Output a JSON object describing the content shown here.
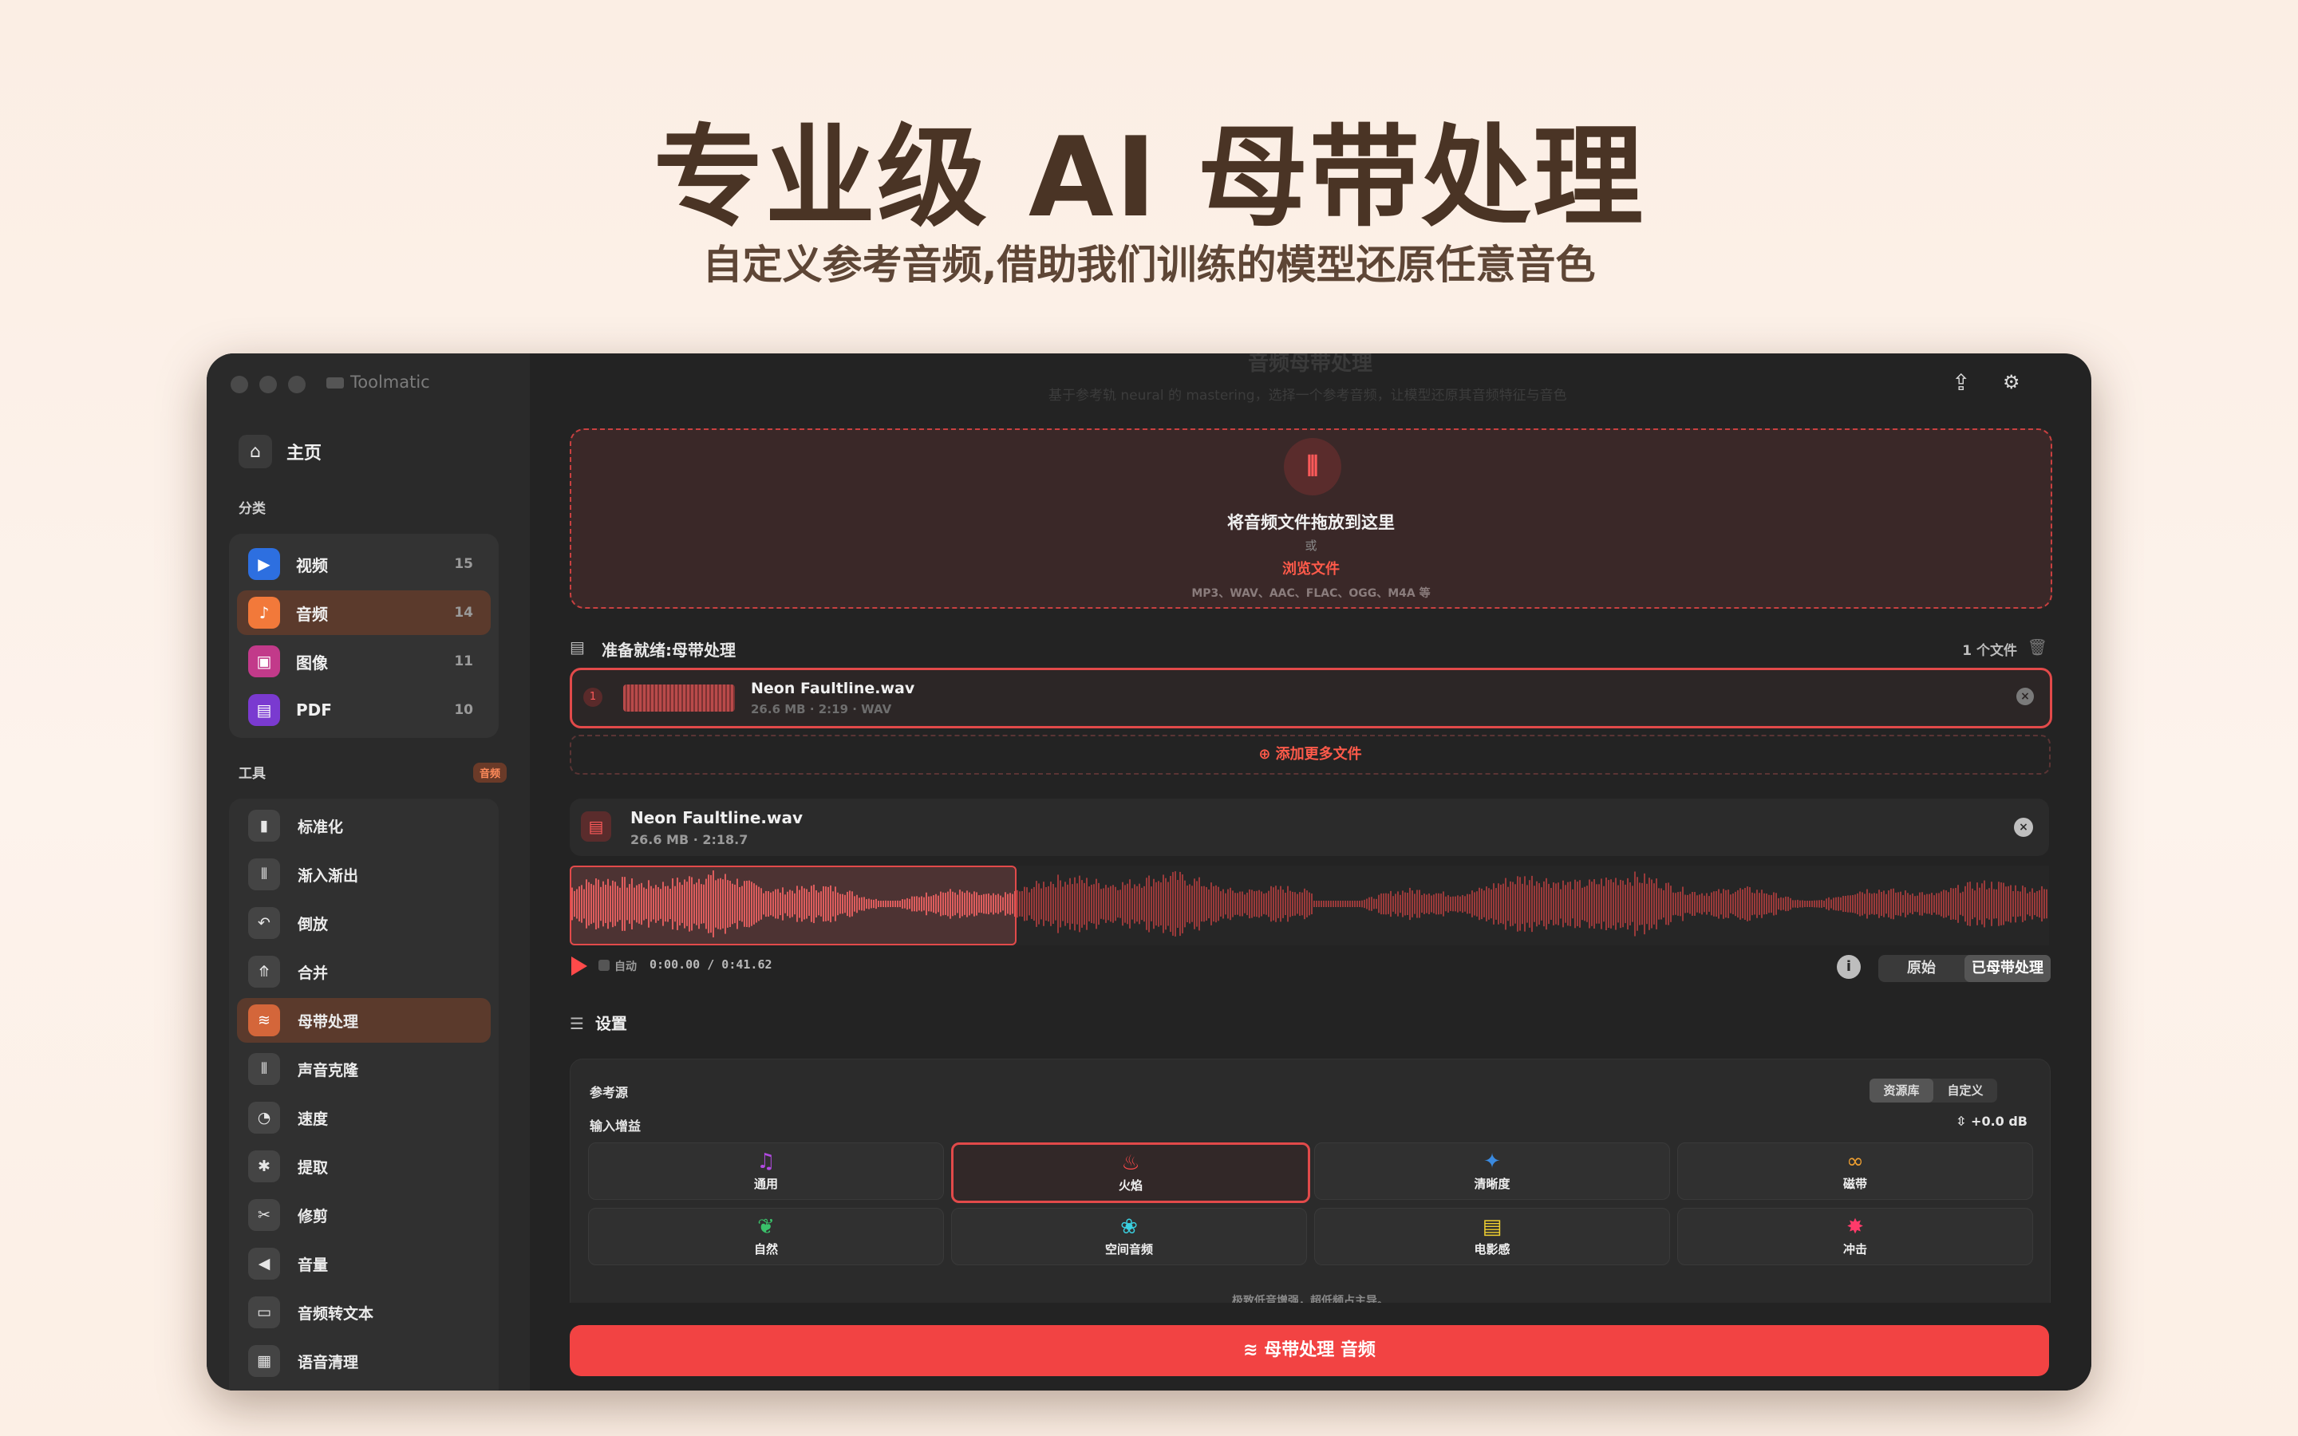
{
  "hero": {
    "title": "专业级 AI 母带处理",
    "subtitle": "自定义参考音频,借助我们训练的模型还原任意音色"
  },
  "window": {
    "app_name": "Toolmatic",
    "header_title": "音频母带处理",
    "header_subtitle": "基于参考轨 neural 的 mastering，选择一个参考音频，让模型还原其音频特征与音色"
  },
  "sidebar": {
    "home_label": "主页",
    "categories_label": "分类",
    "categories": [
      {
        "label": "视频",
        "count": "15",
        "color": "#2d6fe0",
        "icon": "video-icon"
      },
      {
        "label": "音频",
        "count": "14",
        "color": "#f2793a",
        "icon": "music-icon",
        "active": true
      },
      {
        "label": "图像",
        "count": "11",
        "color": "#c23a8a",
        "icon": "image-icon"
      },
      {
        "label": "PDF",
        "count": "10",
        "color": "#7a3ad0",
        "icon": "pdf-icon"
      }
    ],
    "tools_label": "工具",
    "tools_badge": "音频",
    "tools": [
      {
        "label": "标准化",
        "icon": "normalize-icon",
        "glyph": "▮"
      },
      {
        "label": "渐入渐出",
        "icon": "fade-icon",
        "glyph": "⦀"
      },
      {
        "label": "倒放",
        "icon": "reverse-icon",
        "glyph": "↶"
      },
      {
        "label": "合并",
        "icon": "merge-icon",
        "glyph": "⤊"
      },
      {
        "label": "母带处理",
        "icon": "mastering-icon",
        "glyph": "≋",
        "active": true
      },
      {
        "label": "声音克隆",
        "icon": "voice-clone-icon",
        "glyph": "⦀"
      },
      {
        "label": "速度",
        "icon": "speed-icon",
        "glyph": "◔"
      },
      {
        "label": "提取",
        "icon": "extract-icon",
        "glyph": "✱"
      },
      {
        "label": "修剪",
        "icon": "scissors-icon",
        "glyph": "✂"
      },
      {
        "label": "音量",
        "icon": "volume-icon",
        "glyph": "◀"
      },
      {
        "label": "音频转文本",
        "icon": "transcribe-icon",
        "glyph": "▭"
      },
      {
        "label": "语音清理",
        "icon": "voice-clean-icon",
        "glyph": "▦"
      }
    ]
  },
  "dropzone": {
    "title": "将音频文件拖放到这里",
    "or": "或",
    "browse": "浏览文件",
    "formats": "MP3、WAV、AAC、FLAC、OGG、M4A 等"
  },
  "queue": {
    "label": "准备就绪:母带处理",
    "count": "1 个文件",
    "file": {
      "index": "1",
      "name": "Neon Faultline.wav",
      "meta": "26.6 MB · 2:19 · WAV"
    },
    "add_more": "添加更多文件"
  },
  "player": {
    "name": "Neon Faultline.wav",
    "meta": "26.6 MB  ·  2:18.7",
    "auto_label": "自动",
    "time": "0:00.00  /  0:41.62",
    "compare_options": [
      "原始",
      "已母带处理"
    ],
    "compare_selected": "已母带处理",
    "selection_fraction": 0.3
  },
  "settings": {
    "title": "设置",
    "reference_label": "参考源",
    "source_options": [
      "资源库",
      "自定义"
    ],
    "source_selected": "资源库",
    "gain_label": "输入增益",
    "gain_value": "+0.0 dB",
    "presets": [
      {
        "label": "通用",
        "icon": "music-note-icon",
        "glyph": "♫",
        "color": "#b04ae0"
      },
      {
        "label": "火焰",
        "icon": "flame-icon",
        "glyph": "♨",
        "color": "#ff4a4a",
        "selected": true
      },
      {
        "label": "清晰度",
        "icon": "sparkle-icon",
        "glyph": "✦",
        "color": "#3a8ae0"
      },
      {
        "label": "磁带",
        "icon": "tape-icon",
        "glyph": "∞",
        "color": "#f0a030"
      },
      {
        "label": "自然",
        "icon": "leaf-icon",
        "glyph": "❦",
        "color": "#3ac06a"
      },
      {
        "label": "空间音频",
        "icon": "flower-icon",
        "glyph": "❀",
        "color": "#3ad0e0"
      },
      {
        "label": "电影感",
        "icon": "film-icon",
        "glyph": "▤",
        "color": "#f0d030"
      },
      {
        "label": "冲击",
        "icon": "burst-icon",
        "glyph": "✸",
        "color": "#ff3a6a"
      }
    ],
    "preset_note": "极致低音增强，超低频占主导。"
  },
  "action": {
    "run_label": "母带处理 音频"
  },
  "colors": {
    "accent": "#f24343",
    "background": "#232323",
    "sidebar": "#2a2a2a"
  }
}
